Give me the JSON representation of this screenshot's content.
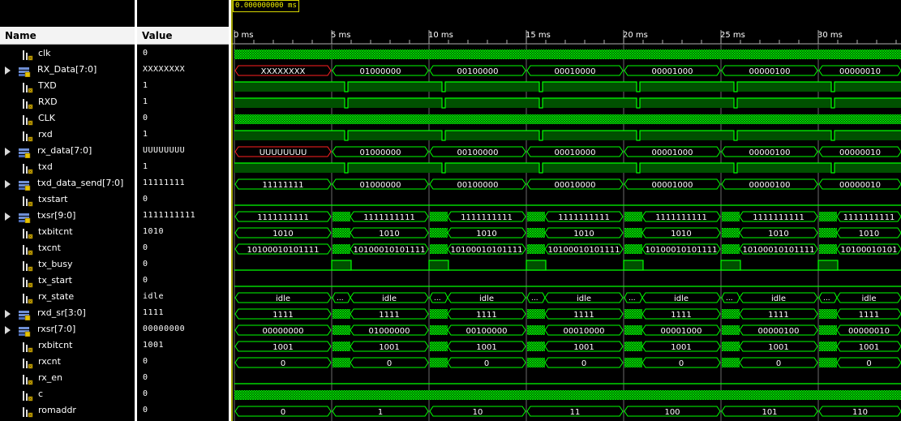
{
  "header": {
    "name_col": "Name",
    "value_col": "Value",
    "cursor_time": "0.000000000 ms"
  },
  "timeline": {
    "ticks": [
      "0 ms",
      "5 ms",
      "10 ms",
      "15 ms",
      "20 ms",
      "25 ms",
      "30 ms"
    ]
  },
  "signals": [
    {
      "name": "clk",
      "value": "0",
      "type": "bit",
      "kind": "clock",
      "expandable": false
    },
    {
      "name": "RX_Data[7:0]",
      "value": "XXXXXXXX",
      "type": "bus",
      "kind": "bus",
      "expandable": true,
      "red_first": true,
      "labels": [
        "XXXXXXXX",
        "01000000",
        "00100000",
        "00010000",
        "00001000",
        "00000100",
        "00000010"
      ]
    },
    {
      "name": "TXD",
      "value": "1",
      "type": "bit",
      "kind": "serial",
      "expandable": false
    },
    {
      "name": "RXD",
      "value": "1",
      "type": "bit",
      "kind": "serial",
      "expandable": false
    },
    {
      "name": "CLK",
      "value": "0",
      "type": "bit",
      "kind": "clock",
      "expandable": false
    },
    {
      "name": "rxd",
      "value": "1",
      "type": "bit",
      "kind": "serial",
      "expandable": false
    },
    {
      "name": "rx_data[7:0]",
      "value": "UUUUUUUU",
      "type": "bus",
      "kind": "bus",
      "expandable": true,
      "red_first": true,
      "labels": [
        "UUUUUUUU",
        "01000000",
        "00100000",
        "00010000",
        "00001000",
        "00000100",
        "00000010"
      ]
    },
    {
      "name": "txd",
      "value": "1",
      "type": "bit",
      "kind": "serial",
      "expandable": false
    },
    {
      "name": "txd_data_send[7:0]",
      "value": "11111111",
      "type": "bus",
      "kind": "bus",
      "expandable": true,
      "labels": [
        "11111111",
        "01000000",
        "00100000",
        "00010000",
        "00001000",
        "00000100",
        "00000010"
      ]
    },
    {
      "name": "txstart",
      "value": "0",
      "type": "bit",
      "kind": "low",
      "expandable": false
    },
    {
      "name": "txsr[9:0]",
      "value": "1111111111",
      "type": "bus",
      "kind": "bus_gap",
      "expandable": true,
      "labels": [
        "1111111111",
        "1111111111",
        "1111111111",
        "1111111111",
        "1111111111",
        "1111111111",
        "1111111111"
      ]
    },
    {
      "name": "txbitcnt",
      "value": "1010",
      "type": "bit",
      "kind": "bus_gap",
      "expandable": false,
      "labels": [
        "1010",
        "1010",
        "1010",
        "1010",
        "1010",
        "1010",
        "1010"
      ]
    },
    {
      "name": "txcnt",
      "value": "0",
      "type": "bit",
      "kind": "bus_gap",
      "expandable": false,
      "labels": [
        "10100010101111",
        "10100010101111",
        "10100010101111",
        "10100010101111",
        "10100010101111",
        "10100010101111",
        "10100010101"
      ]
    },
    {
      "name": "tx_busy",
      "value": "0",
      "type": "bit",
      "kind": "busy",
      "expandable": false
    },
    {
      "name": "tx_start",
      "value": "0",
      "type": "bit",
      "kind": "low",
      "expandable": false
    },
    {
      "name": "rx_state",
      "value": "idle",
      "type": "bit",
      "kind": "bus_dots",
      "expandable": false,
      "labels": [
        "idle",
        "idle",
        "idle",
        "idle",
        "idle",
        "idle",
        "idle"
      ]
    },
    {
      "name": "rxd_sr[3:0]",
      "value": "1111",
      "type": "bus",
      "kind": "bus_gap",
      "expandable": true,
      "labels": [
        "1111",
        "1111",
        "1111",
        "1111",
        "1111",
        "1111",
        "1111"
      ]
    },
    {
      "name": "rxsr[7:0]",
      "value": "00000000",
      "type": "bus",
      "kind": "bus_gap",
      "expandable": true,
      "labels": [
        "00000000",
        "01000000",
        "00100000",
        "00010000",
        "00001000",
        "00000100",
        "00000010"
      ]
    },
    {
      "name": "rxbitcnt",
      "value": "1001",
      "type": "bit",
      "kind": "bus_gap",
      "expandable": false,
      "labels": [
        "1001",
        "1001",
        "1001",
        "1001",
        "1001",
        "1001",
        "1001"
      ]
    },
    {
      "name": "rxcnt",
      "value": "0",
      "type": "bit",
      "kind": "bus_gap",
      "expandable": false,
      "labels": [
        "0",
        "0",
        "0",
        "0",
        "0",
        "0",
        "0"
      ]
    },
    {
      "name": "rx_en",
      "value": "0",
      "type": "bit",
      "kind": "low",
      "expandable": false
    },
    {
      "name": "c",
      "value": "0",
      "type": "bit",
      "kind": "clock",
      "expandable": false
    },
    {
      "name": "romaddr",
      "value": "0",
      "type": "bit",
      "kind": "bus",
      "expandable": false,
      "labels": [
        "0",
        "1",
        "10",
        "11",
        "100",
        "101",
        "110"
      ]
    }
  ],
  "colors": {
    "signal": "#00ff00",
    "fill": "#005000",
    "error": "#ff2020",
    "grid": "#b0b0b0"
  }
}
